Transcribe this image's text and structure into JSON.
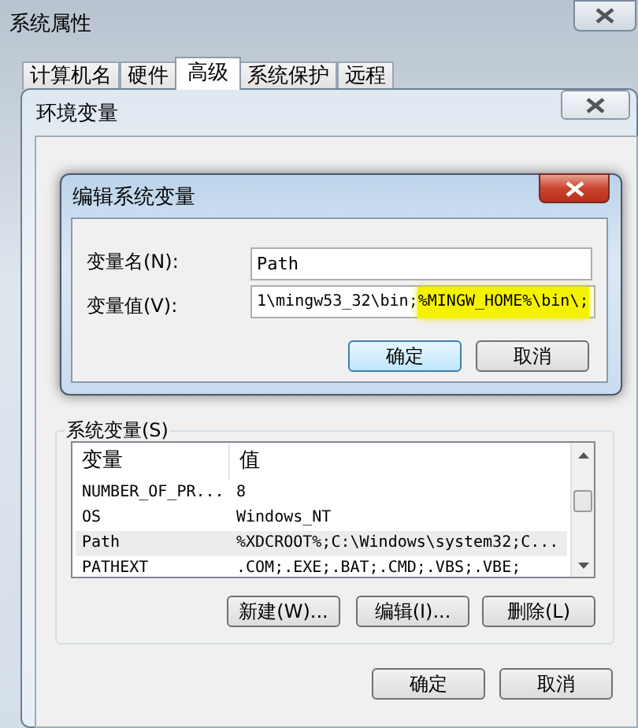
{
  "system_properties": {
    "title": "系统属性",
    "tabs": [
      {
        "label": "计算机名",
        "selected": false
      },
      {
        "label": "硬件",
        "selected": false
      },
      {
        "label": "高级",
        "selected": true
      },
      {
        "label": "系统保护",
        "selected": false
      },
      {
        "label": "远程",
        "selected": false
      }
    ]
  },
  "env_vars": {
    "title": "环境变量",
    "system_group": {
      "label": "系统变量(S)",
      "columns": [
        "变量",
        "值"
      ],
      "rows": [
        {
          "name": "NUMBER_OF_PR...",
          "value": "8",
          "selected": false
        },
        {
          "name": "OS",
          "value": "Windows_NT",
          "selected": false
        },
        {
          "name": "Path",
          "value": "%XDCROOT%;C:\\Windows\\system32;C...",
          "selected": true
        },
        {
          "name": "PATHEXT",
          "value": ".COM;.EXE;.BAT;.CMD;.VBS;.VBE;",
          "selected": false
        }
      ],
      "buttons": [
        "新建(W)...",
        "编辑(I)...",
        "删除(L)"
      ]
    },
    "buttons": [
      "确定",
      "取消"
    ]
  },
  "edit_dialog": {
    "title": "编辑系统变量",
    "name_label": "变量名(N):",
    "name_value": "Path",
    "value_label": "变量值(V):",
    "value_parts": [
      {
        "text": "1\\mingw53_32\\bin;",
        "highlighted": false
      },
      {
        "text": "%MINGW_HOME%\\bin\\;",
        "highlighted": true
      }
    ],
    "buttons": [
      "确定",
      "取消"
    ]
  }
}
